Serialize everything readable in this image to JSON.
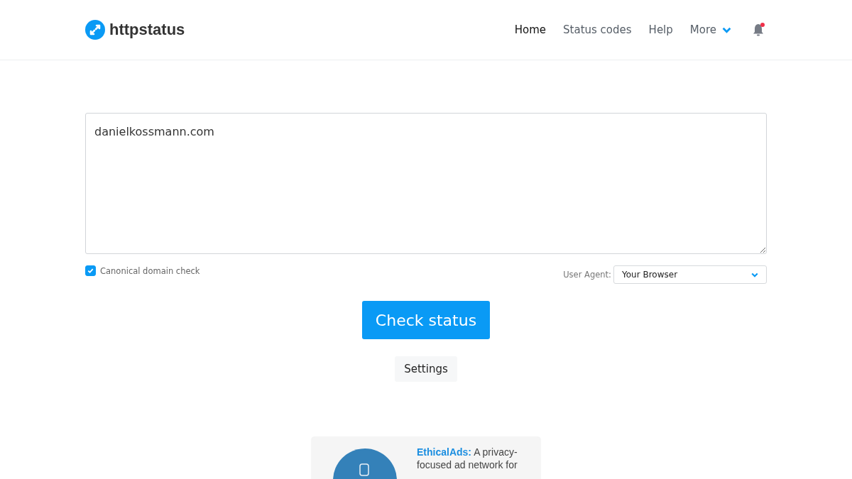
{
  "brand": {
    "name": "httpstatus"
  },
  "nav": [
    {
      "label": "Home",
      "selected": true
    },
    {
      "label": "Status codes",
      "selected": false
    },
    {
      "label": "Help",
      "selected": false
    },
    {
      "label": "More",
      "selected": false,
      "kind": "dropdown"
    }
  ],
  "notifications": {
    "unread": true
  },
  "url_input": {
    "value": "danielkossmann.com"
  },
  "canonical_check": {
    "label": "Canonical domain check",
    "checked": true
  },
  "user_agent": {
    "label": "User Agent:",
    "value": "Your Browser"
  },
  "check_button": "Check status",
  "settings_button": "Settings",
  "ad": {
    "text": "**EthicalAds:** A privacy-focused ad network for"
  }
}
